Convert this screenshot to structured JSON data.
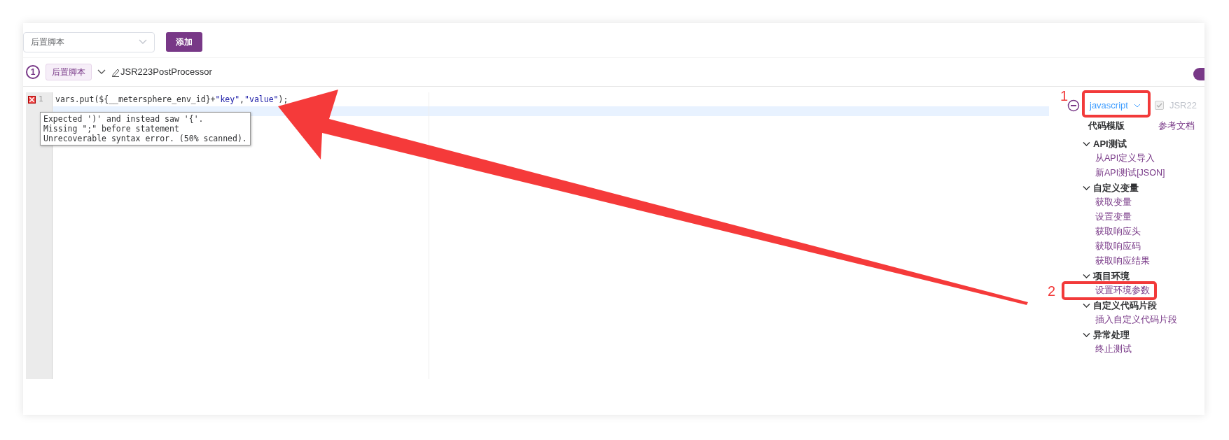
{
  "toolbar": {
    "select": {
      "value": "后置脚本"
    },
    "add_button": "添加"
  },
  "processor": {
    "index": "1",
    "tag": "后置脚本",
    "expanded": true,
    "name": "JSR223PostProcessor",
    "on": true
  },
  "editor": {
    "lines": [
      {
        "number": "1",
        "error": true,
        "tokens": [
          {
            "kind": "plain",
            "text": "vars.put(${__metersphere_env_id}+"
          },
          {
            "kind": "string",
            "text": "\"key\""
          },
          {
            "kind": "plain",
            "text": ","
          },
          {
            "kind": "string",
            "text": "\"value\""
          },
          {
            "kind": "plain",
            "text": ");"
          }
        ]
      }
    ],
    "tooltip": [
      "Expected ')' and instead saw '{'.",
      "Missing \";\" before statement",
      "Unrecoverable syntax error. (50% scanned)."
    ]
  },
  "side": {
    "language": "javascript",
    "checkbox_label": "JSR22",
    "checked": true,
    "template_title": "代码模版",
    "docs_link": "参考文档",
    "groups": [
      {
        "title": "API测试",
        "expanded": true,
        "items": [
          "从API定义导入",
          "新API测试[JSON]"
        ]
      },
      {
        "title": "自定义变量",
        "expanded": true,
        "items": [
          "获取变量",
          "设置变量",
          "获取响应头",
          "获取响应码",
          "获取响应结果"
        ]
      },
      {
        "title": "项目环境",
        "expanded": true,
        "items": [
          "设置环境参数"
        ]
      },
      {
        "title": "自定义代码片段",
        "expanded": true,
        "items": [
          "插入自定义代码片段"
        ]
      },
      {
        "title": "异常处理",
        "expanded": true,
        "items": [
          "终止测试"
        ]
      }
    ]
  },
  "annotations": [
    {
      "label": "1"
    },
    {
      "label": "2"
    }
  ]
}
